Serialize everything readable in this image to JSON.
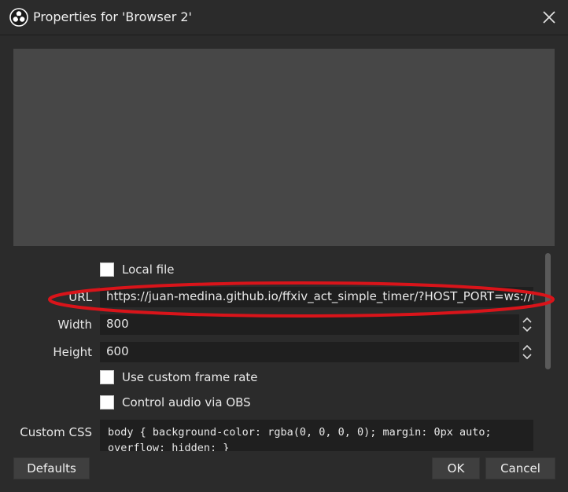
{
  "window": {
    "title": "Properties for 'Browser 2'"
  },
  "properties": {
    "local_file_label": "Local file",
    "url_label": "URL",
    "url_value": "https://juan-medina.github.io/ffxiv_act_simple_timer/?HOST_PORT=ws://lc",
    "width_label": "Width",
    "width_value": "800",
    "height_label": "Height",
    "height_value": "600",
    "custom_frame_rate_label": "Use custom frame rate",
    "control_audio_label": "Control audio via OBS",
    "custom_css_label": "Custom CSS",
    "custom_css_value": "body { background-color: rgba(0, 0, 0, 0); margin: 0px auto; overflow: hidden; }"
  },
  "buttons": {
    "defaults": "Defaults",
    "ok": "OK",
    "cancel": "Cancel"
  },
  "colors": {
    "background": "#2b2b2b",
    "preview": "#474747",
    "field": "#1f1f1f",
    "annotation": "#d9141a"
  },
  "icons": {
    "app": "obs-logo-icon",
    "close": "close-icon",
    "spin": "spin-up-down-icon"
  }
}
